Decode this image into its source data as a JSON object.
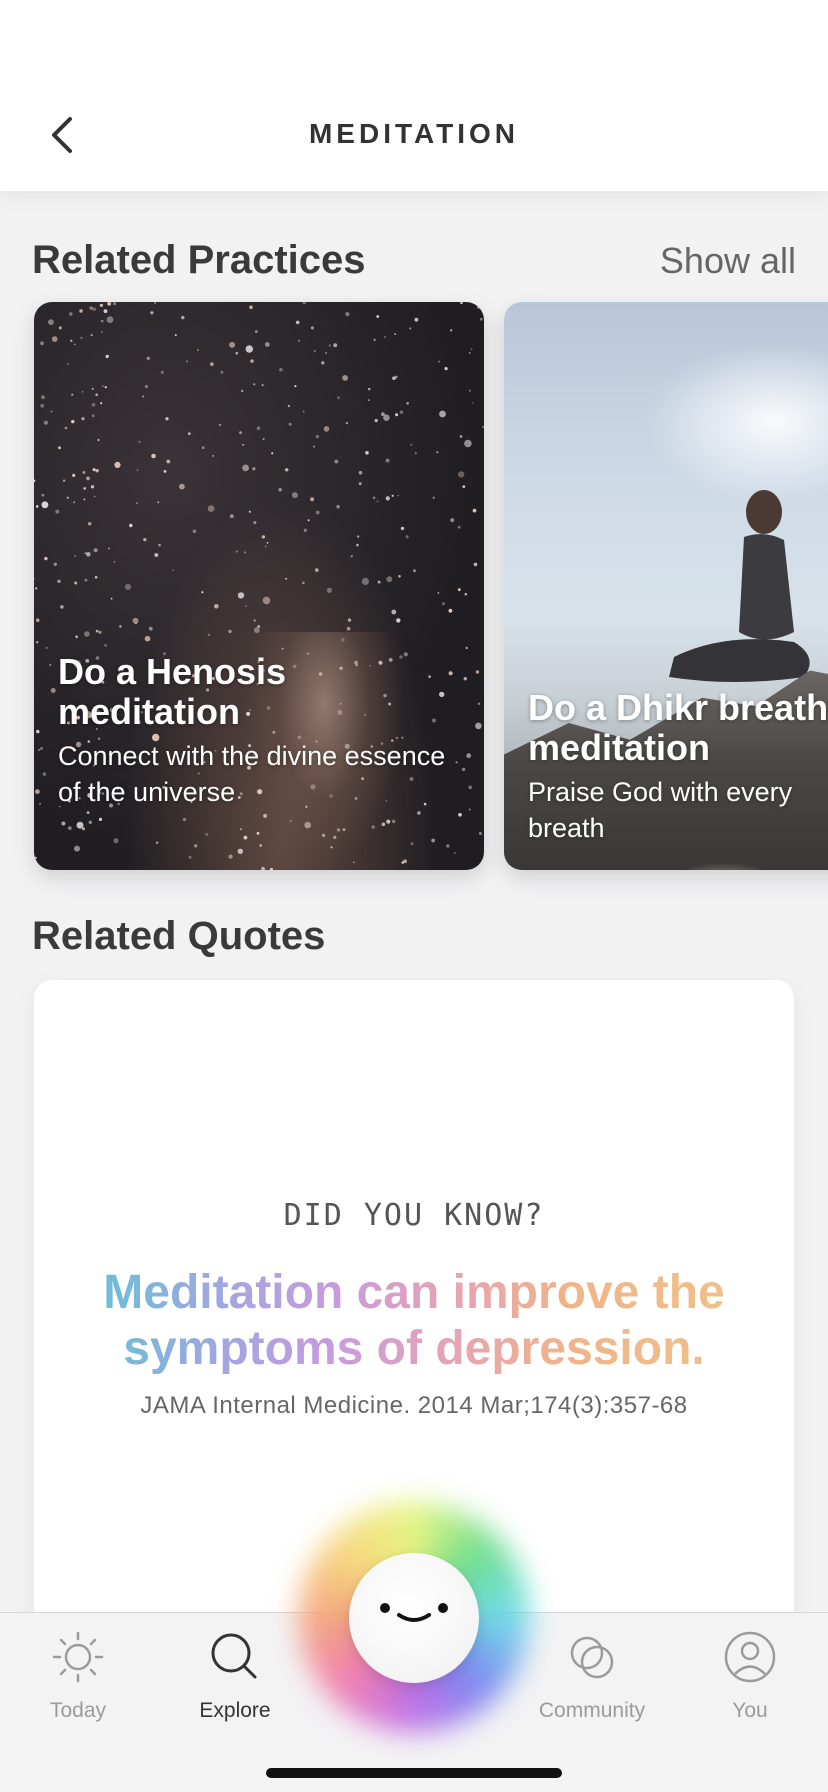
{
  "header": {
    "title": "MEDITATION"
  },
  "practices": {
    "heading": "Related Practices",
    "show_all": "Show all",
    "cards": [
      {
        "title": "Do a Henosis meditation",
        "subtitle": "Connect with the divine essence of the universe"
      },
      {
        "title": "Do a Dhikr breath meditation",
        "subtitle": "Praise God with every breath"
      }
    ]
  },
  "quotes": {
    "heading": "Related Quotes",
    "kicker": "DID YOU KNOW?",
    "text": "Meditation can improve the symptoms of depression.",
    "source": "JAMA Internal Medicine. 2014 Mar;174(3):357-68"
  },
  "tabbar": {
    "tabs": [
      {
        "label": "Today",
        "icon": "sun-icon"
      },
      {
        "label": "Explore",
        "icon": "search-icon"
      },
      {
        "label": "Community",
        "icon": "community-icon"
      },
      {
        "label": "You",
        "icon": "profile-icon"
      }
    ],
    "active": "Explore"
  },
  "colors": {
    "gradient": [
      "#5cc7d3",
      "#c79ae0",
      "#e6a3b5",
      "#f0c38a"
    ]
  }
}
